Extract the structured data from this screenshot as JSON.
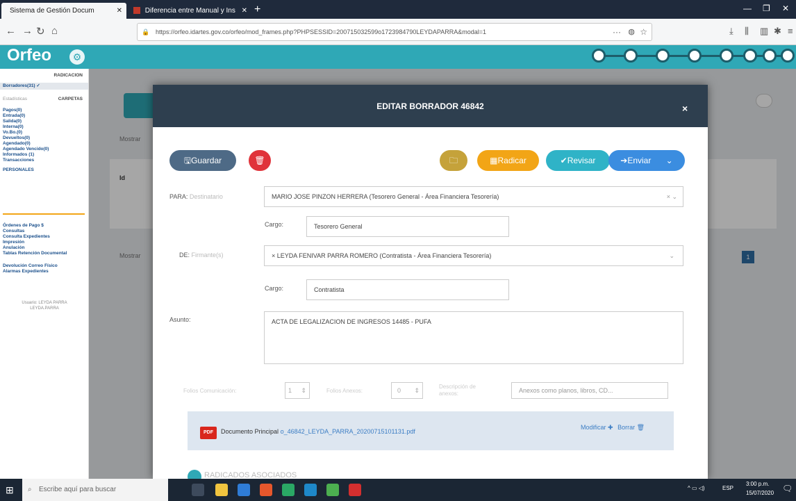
{
  "browser": {
    "tabs": [
      {
        "title": "Sistema de Gestión Docum",
        "close": "✕"
      },
      {
        "title": "Diferencia entre Manual y Ins",
        "close": "✕"
      }
    ],
    "new_tab": "+",
    "url": "https://orfeo.idartes.gov.co/orfeo/mod_frames.php?PHPSESSID=200715032599o1723984790LEYDAPARRA&modal=1",
    "menu_dots": "···"
  },
  "app": {
    "logo": "Orfeo",
    "sidebar": {
      "radicacion_header": "RADICACION",
      "borradores": "Borradores(31) ✓",
      "estadisticas": "Estadísticas",
      "carpetas_header": "CARPETAS",
      "folders": [
        "Pagos(0)",
        "Entrada(0)",
        "Salida(0)",
        "Interna(0)",
        "Vo.Bo.(0)",
        "Devueltos(0)",
        "Agendado(0)",
        "Agendado Vencido(0)",
        "Informados (1)",
        "Transacciones",
        "PERSONALES"
      ],
      "links": [
        "Órdenes de Pago $",
        "Consultas",
        "Consulta Expedientes",
        "Impresión",
        "Anulación",
        "Tablas Retención Documental",
        "Devolución Correo Físico",
        "Alarmas Expedientes"
      ],
      "user_line_1": "Usuario: LEYDA PARRA",
      "user_line_2": "LEYDA.PARRA"
    },
    "background": {
      "mostrar_1": "Mostrar",
      "mostrar_2": "Mostrar",
      "column_id": "Id",
      "page_number": "1"
    }
  },
  "modal": {
    "title": "EDITAR BORRADOR 46842",
    "close": "×",
    "buttons": {
      "guardar": "Guardar",
      "radicar": "Radicar",
      "revisar": "Revisar",
      "enviar": "Enviar",
      "enviar_caret": "⌄"
    },
    "para_label": "PARA:",
    "para_hint": "Destinatario",
    "para_value": "MARIO JOSE PINZON HERRERA (Tesorero General - Área Financiera Tesorería)",
    "para_clear": "× ⌄",
    "cargo_label_1": "Cargo:",
    "cargo_value_1": "Tesorero General",
    "de_label": "DE:",
    "de_hint": "Firmante(s)",
    "de_value": "× LEYDA FENIVAR PARRA ROMERO (Contratista - Área Financiera Tesorería)",
    "de_caret": "⌄",
    "cargo_label_2": "Cargo:",
    "cargo_value_2": "Contratista",
    "asunto_label": "Asunto:",
    "asunto_value": "ACTA DE LEGALIZACION DE INGRESOS 14485 - PUFA",
    "folios_label": "Folios Comunicación:",
    "folios_value": "1",
    "anexos_label": "Folios Anexos:",
    "anexos_value": "0",
    "descripcion_label": "Descripción de anexos:",
    "anexos_placeholder": "Anexos como planos, libros, CD...",
    "doc_label": "Documento Principal",
    "doc_file": "o_46842_LEYDA_PARRA_20200715101131.pdf",
    "pdf_badge": "PDF",
    "modificar": "Modificar",
    "borrar": "Borrar",
    "radicados_header": "RADICADOS ASOCIADOS"
  },
  "taskbar": {
    "search_placeholder": "Escribe aquí para buscar",
    "time": "3:00 p.m.",
    "date": "15/07/2020",
    "lang": "ESP"
  },
  "colors": {
    "header_teal": "#2fa8b6",
    "modal_header": "#2e3f4f",
    "guardar": "#4e6a86",
    "delete": "#e0333a",
    "folder": "#c5a23a",
    "radicar": "#f2a516",
    "revisar": "#2fb3c7",
    "enviar": "#3b8de0"
  }
}
